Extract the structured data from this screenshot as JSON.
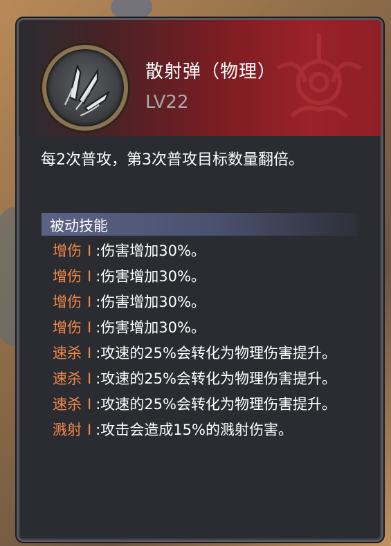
{
  "skill": {
    "name": "散射弹（物理）",
    "level": "LV22",
    "description": "每2次普攻，第3次普攻目标数量翻倍。",
    "icon": "scatter-bullets-icon"
  },
  "passive": {
    "title": "被动技能",
    "separator": "I",
    "effects": [
      {
        "name": "增伤",
        "text": ":伤害增加30%。"
      },
      {
        "name": "增伤",
        "text": ":伤害增加30%。"
      },
      {
        "name": "增伤",
        "text": ":伤害增加30%。"
      },
      {
        "name": "增伤",
        "text": ":伤害增加30%。"
      },
      {
        "name": "速杀",
        "text": ":攻速的25%会转化为物理伤害提升。"
      },
      {
        "name": "速杀",
        "text": ":攻速的25%会转化为物理伤害提升。"
      },
      {
        "name": "速杀",
        "text": ":攻速的25%会转化为物理伤害提升。"
      },
      {
        "name": "溅射",
        "text": ":攻击会造成15%的溅射伤害。"
      }
    ]
  },
  "colors": {
    "effect_name": "#f2884a",
    "header_red": "#9a2228",
    "section_bar": "#5a6286",
    "panel_bg": "#2a2c31"
  }
}
